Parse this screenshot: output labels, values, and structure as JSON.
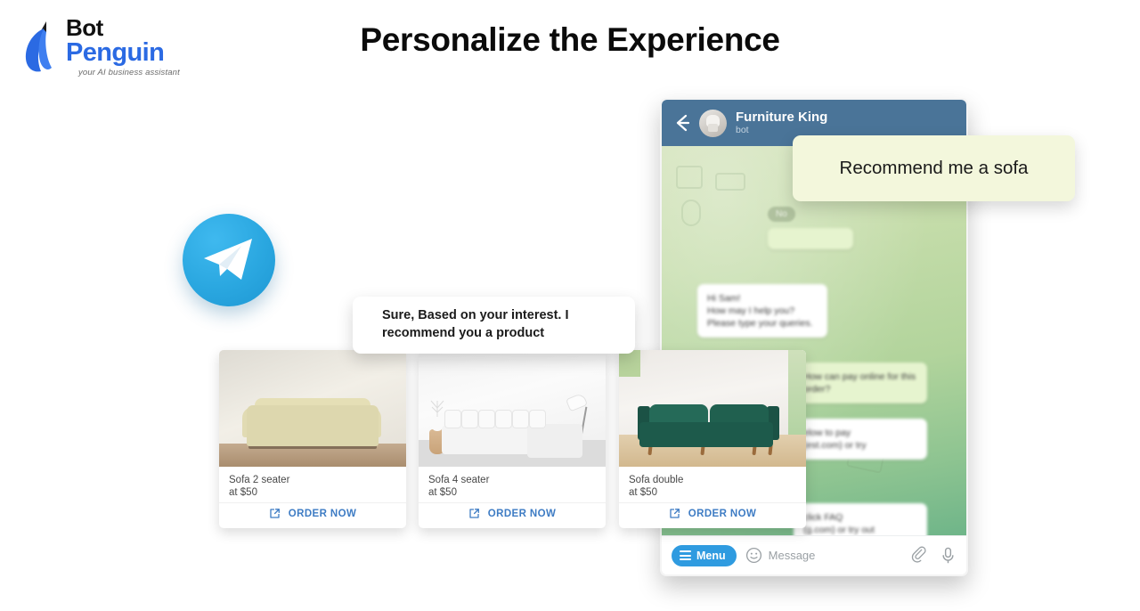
{
  "brand": {
    "name_line1": "Bot",
    "name_line2": "Penguin",
    "tagline": "your AI business assistant",
    "penguin_color": "#2b6ae3"
  },
  "page_title": "Personalize the Experience",
  "channel": {
    "icon": "telegram-icon",
    "accent": "#2aa7e0"
  },
  "phone": {
    "header": {
      "back_icon": "back-arrow-icon",
      "avatar_icon": "chair-avatar",
      "title": "Furniture King",
      "subtitle": "bot",
      "bg_color": "#4a7498"
    },
    "date_pill": "No",
    "background_messages": [
      {
        "direction": "out",
        "text": "",
        "meta": ""
      },
      {
        "direction": "in",
        "text": "Hi Sam!\nHow may I help you? Please type your queries.",
        "meta": ""
      },
      {
        "direction": "out",
        "text": "How can pay online for this order?",
        "meta": ""
      },
      {
        "direction": "in",
        "text": "elow to pay\n(est.com) or try",
        "meta": ""
      },
      {
        "direction": "in",
        "text": "click FAQ\n(g.com) or try out",
        "meta": ""
      }
    ],
    "input_bar": {
      "menu_label": "Menu",
      "menu_icon": "hamburger-icon",
      "emoji_icon": "smiley-icon",
      "message_placeholder": "Message",
      "message_value": "",
      "attach_icon": "paperclip-icon",
      "voice_icon": "microphone-icon",
      "menu_color": "#2f9be0"
    }
  },
  "overlays": {
    "user_message": "Recommend me a sofa",
    "user_bubble_color": "#f3f7dc",
    "bot_message": "Sure, Based on your interest. I recommend you a product",
    "bot_bubble_color": "#ffffff"
  },
  "product_cards": [
    {
      "image": "cream-leather-sofa",
      "name": "Sofa 2 seater",
      "price": "at $50",
      "action_label": "ORDER NOW",
      "action_icon": "external-link-icon"
    },
    {
      "image": "white-sectional-sofa",
      "name": "Sofa 4 seater",
      "price": "at $50",
      "action_label": "ORDER NOW",
      "action_icon": "external-link-icon"
    },
    {
      "image": "green-velvet-sofa",
      "name": "Sofa double",
      "price": "at $50",
      "action_label": "ORDER NOW",
      "action_icon": "external-link-icon"
    }
  ],
  "colors": {
    "link_blue": "#3e7cc4",
    "title_black": "#0b0b0b"
  }
}
